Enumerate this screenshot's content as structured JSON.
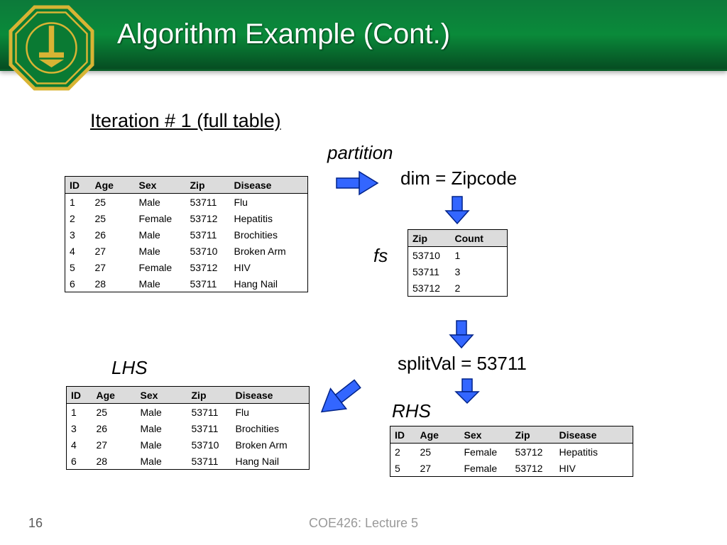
{
  "header": {
    "title": "Algorithm Example (Cont.)"
  },
  "iteration_title": "Iteration # 1 (full table)",
  "labels": {
    "partition": "partition",
    "dim": "dim = Zipcode",
    "fs": "fs",
    "splitval": "splitVal = 53711",
    "lhs": "LHS",
    "rhs": "RHS"
  },
  "full_table": {
    "headers": [
      "ID",
      "Age",
      "Sex",
      "Zip",
      "Disease"
    ],
    "rows": [
      [
        "1",
        "25",
        "Male",
        "53711",
        "Flu"
      ],
      [
        "2",
        "25",
        "Female",
        "53712",
        "Hepatitis"
      ],
      [
        "3",
        "26",
        "Male",
        "53711",
        "Brochities"
      ],
      [
        "4",
        "27",
        "Male",
        "53710",
        "Broken Arm"
      ],
      [
        "5",
        "27",
        "Female",
        "53712",
        "HIV"
      ],
      [
        "6",
        "28",
        "Male",
        "53711",
        "Hang Nail"
      ]
    ]
  },
  "zip_table": {
    "headers": [
      "Zip",
      "Count"
    ],
    "rows": [
      [
        "53710",
        "1"
      ],
      [
        "53711",
        "3"
      ],
      [
        "53712",
        "2"
      ]
    ]
  },
  "lhs_table": {
    "headers": [
      "ID",
      "Age",
      "Sex",
      "Zip",
      "Disease"
    ],
    "rows": [
      [
        "1",
        "25",
        "Male",
        "53711",
        "Flu"
      ],
      [
        "3",
        "26",
        "Male",
        "53711",
        "Brochities"
      ],
      [
        "4",
        "27",
        "Male",
        "53710",
        "Broken Arm"
      ],
      [
        "6",
        "28",
        "Male",
        "53711",
        "Hang Nail"
      ]
    ]
  },
  "rhs_table": {
    "headers": [
      "ID",
      "Age",
      "Sex",
      "Zip",
      "Disease"
    ],
    "rows": [
      [
        "2",
        "25",
        "Female",
        "53712",
        "Hepatitis"
      ],
      [
        "5",
        "27",
        "Female",
        "53712",
        "HIV"
      ]
    ]
  },
  "footer": {
    "page": "16",
    "center": "COE426: Lecture 5"
  }
}
